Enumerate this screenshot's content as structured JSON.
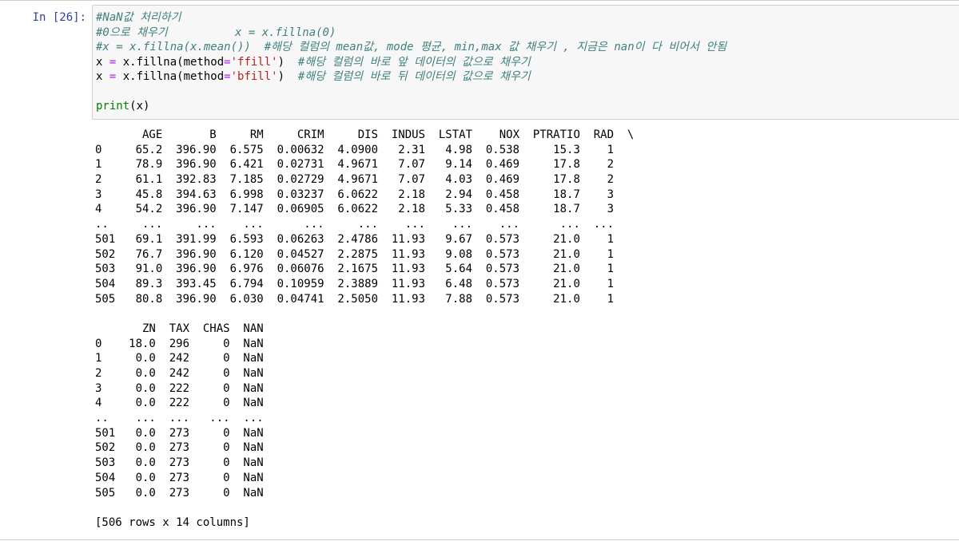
{
  "cell": {
    "prompt": "In [26]:",
    "code_lines": [
      {
        "segments": [
          {
            "cls": "cm-comment",
            "text": "#NaN값 처리하기"
          }
        ]
      },
      {
        "segments": [
          {
            "cls": "cm-comment",
            "text": "#0으로 채우기          x = x.fillna(0)"
          }
        ]
      },
      {
        "segments": [
          {
            "cls": "cm-comment",
            "text": "#x = x.fillna(x.mean())  #해당 컬럼의 mean값, mode 평균, min,max 값 채우기 , 지금은 nan이 다 비어서 안됨"
          }
        ]
      },
      {
        "segments": [
          {
            "cls": "",
            "text": "x "
          },
          {
            "cls": "cm-op",
            "text": "="
          },
          {
            "cls": "",
            "text": " x.fillna(method"
          },
          {
            "cls": "cm-op",
            "text": "="
          },
          {
            "cls": "cm-string",
            "text": "'ffill'"
          },
          {
            "cls": "",
            "text": ")  "
          },
          {
            "cls": "cm-comment",
            "text": "#해당 컬럼의 바로 앞 데이터의 값으로 채우기"
          }
        ]
      },
      {
        "segments": [
          {
            "cls": "",
            "text": "x "
          },
          {
            "cls": "cm-op",
            "text": "="
          },
          {
            "cls": "",
            "text": " x.fillna(method"
          },
          {
            "cls": "cm-op",
            "text": "="
          },
          {
            "cls": "cm-string",
            "text": "'bfill'"
          },
          {
            "cls": "",
            "text": ")  "
          },
          {
            "cls": "cm-comment",
            "text": "#해당 컬럼의 바로 뒤 데이터의 값으로 채우기"
          }
        ]
      },
      {
        "segments": [
          {
            "cls": "",
            "text": ""
          }
        ]
      },
      {
        "segments": [
          {
            "cls": "cm-builtin",
            "text": "print"
          },
          {
            "cls": "",
            "text": "(x)"
          }
        ]
      }
    ]
  },
  "output": {
    "lines": [
      "       AGE       B     RM     CRIM     DIS  INDUS  LSTAT    NOX  PTRATIO  RAD  \\",
      "0     65.2  396.90  6.575  0.00632  4.0900   2.31   4.98  0.538     15.3    1",
      "1     78.9  396.90  6.421  0.02731  4.9671   7.07   9.14  0.469     17.8    2",
      "2     61.1  392.83  7.185  0.02729  4.9671   7.07   4.03  0.469     17.8    2",
      "3     45.8  394.63  6.998  0.03237  6.0622   2.18   2.94  0.458     18.7    3",
      "4     54.2  396.90  7.147  0.06905  6.0622   2.18   5.33  0.458     18.7    3",
      "..     ...     ...    ...      ...     ...    ...    ...    ...      ...  ...",
      "501   69.1  391.99  6.593  0.06263  2.4786  11.93   9.67  0.573     21.0    1",
      "502   76.7  396.90  6.120  0.04527  2.2875  11.93   9.08  0.573     21.0    1",
      "503   91.0  396.90  6.976  0.06076  2.1675  11.93   5.64  0.573     21.0    1",
      "504   89.3  393.45  6.794  0.10959  2.3889  11.93   6.48  0.573     21.0    1",
      "505   80.8  396.90  6.030  0.04741  2.5050  11.93   7.88  0.573     21.0    1",
      "",
      "       ZN  TAX  CHAS  NAN",
      "0    18.0  296     0  NaN",
      "1     0.0  242     0  NaN",
      "2     0.0  242     0  NaN",
      "3     0.0  222     0  NaN",
      "4     0.0  222     0  NaN",
      "..    ...  ...   ...  ...",
      "501   0.0  273     0  NaN",
      "502   0.0  273     0  NaN",
      "503   0.0  273     0  NaN",
      "504   0.0  273     0  NaN",
      "505   0.0  273     0  NaN",
      "",
      "[506 rows x 14 columns]"
    ]
  }
}
